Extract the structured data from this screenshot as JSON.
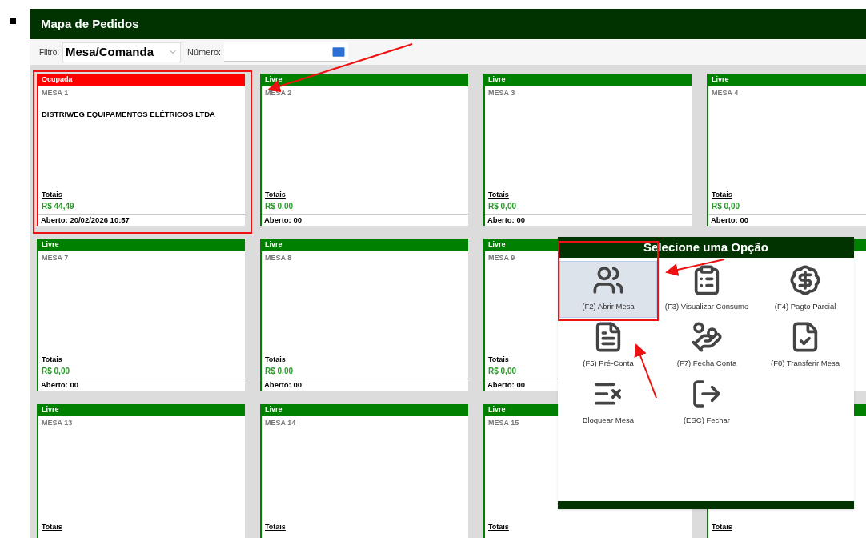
{
  "page": {
    "title": "Mapa de Pedidos"
  },
  "filter": {
    "label": "Filtro:",
    "value": "Mesa/Comanda",
    "number_label": "Número:"
  },
  "tables": [
    {
      "color": "#ff0000",
      "status_label": "Ocupada",
      "table": "MESA 1",
      "customer": "DISTRIWEG EQUIPAMENTOS ELÉTRICOS LTDA",
      "totals_label": "Totais",
      "total": "R$ 44,49",
      "opened": "Aberto: 20/02/2026 10:57"
    },
    {
      "color": "#008000",
      "status_label": "Livre",
      "table": "MESA 2",
      "totals_label": "Totais",
      "total": "R$ 0,00",
      "opened": "Aberto: 00"
    },
    {
      "color": "#008000",
      "status_label": "Livre",
      "table": "MESA 3",
      "totals_label": "Totais",
      "total": "R$ 0,00",
      "opened": "Aberto: 00"
    },
    {
      "color": "#008000",
      "status_label": "Livre",
      "table": "MESA 4",
      "totals_label": "Totais",
      "total": "R$ 0,00",
      "opened": "Aberto: 00"
    },
    {
      "color": "#008000",
      "status_label": "Livre",
      "table": "MESA 7",
      "totals_label": "Totais",
      "total": "R$ 0,00",
      "opened": "Aberto: 00"
    },
    {
      "color": "#008000",
      "status_label": "Livre",
      "table": "MESA 8",
      "totals_label": "Totais",
      "total": "R$ 0,00",
      "opened": "Aberto: 00"
    },
    {
      "color": "#008000",
      "status_label": "Livre",
      "table": "MESA 9",
      "totals_label": "Totais",
      "total": "R$ 0,00",
      "opened": "Aberto: 00"
    },
    {
      "color": "#008000"
    },
    {
      "color": "#008000",
      "status_label": "Livre",
      "table": "MESA 13",
      "totals_label": "Totais"
    },
    {
      "color": "#008000",
      "status_label": "Livre",
      "table": "MESA 14",
      "totals_label": "Totais"
    },
    {
      "color": "#008000",
      "status_label": "Livre",
      "table": "MESA 15",
      "totals_label": "Totais"
    },
    {
      "color": "#008000",
      "totals_label": "Totais"
    }
  ],
  "dialog": {
    "title": "Selecione uma Opção",
    "options": [
      {
        "kind": "open",
        "label": "(F2) Abrir Mesa",
        "selected": true
      },
      {
        "kind": "consumption",
        "label": "(F3) Visualizar Consumo",
        "selected": false
      },
      {
        "kind": "partial",
        "label": "(F4) Pagto Parcial",
        "selected": false
      },
      {
        "kind": "precheck",
        "label": "(F5) Pré-Conta",
        "selected": false
      },
      {
        "kind": "close_bill",
        "label": "(F7) Fecha Conta",
        "selected": false
      },
      {
        "kind": "transfer",
        "label": "(F8) Transferir Mesa",
        "selected": false
      },
      {
        "kind": "block",
        "label": "Bloquear Mesa",
        "selected": false
      },
      {
        "kind": "exit",
        "label": "(ESC) Fechar",
        "selected": false
      }
    ]
  }
}
